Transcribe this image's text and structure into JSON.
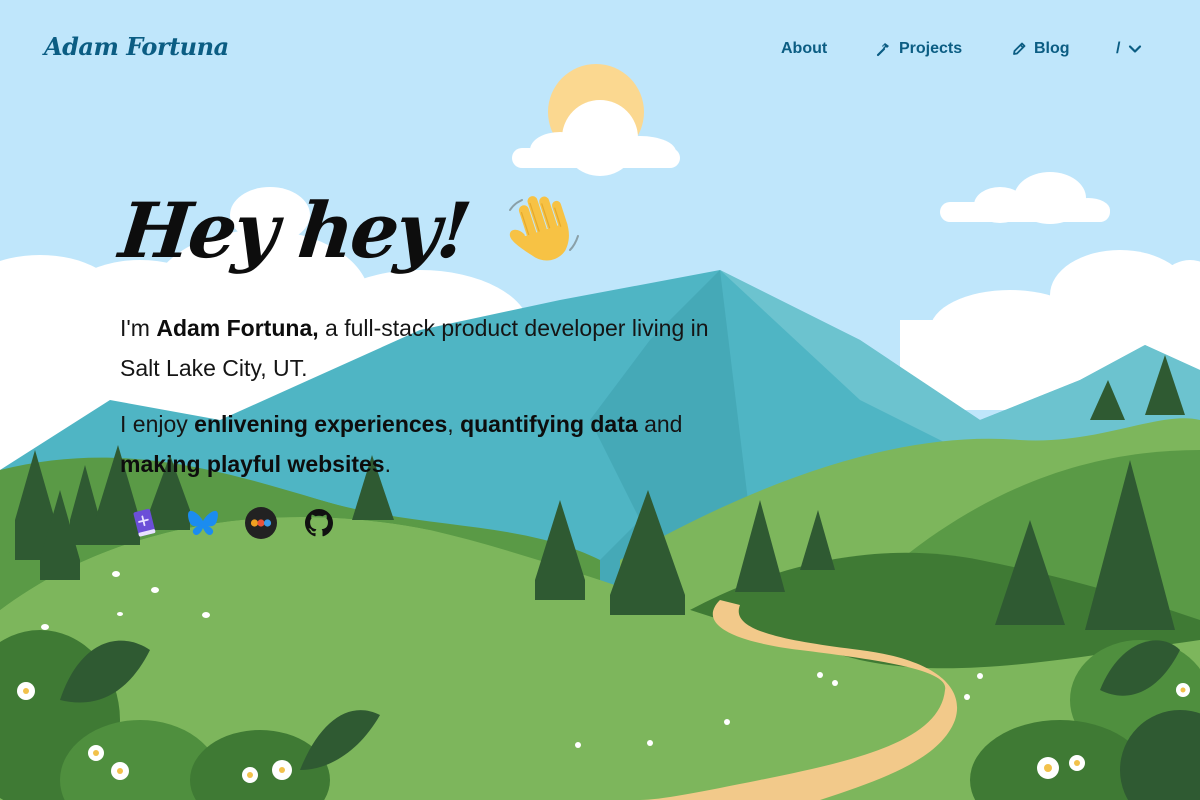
{
  "site": {
    "logo_text": "Adam Fortuna"
  },
  "nav": {
    "about": "About",
    "projects": "Projects",
    "blog": "Blog",
    "language": "/"
  },
  "hero": {
    "greeting": "Hey hey!",
    "intro_prefix": "I'm ",
    "name": "Adam Fortuna,",
    "intro_suffix": " a full-stack product developer living in Salt Lake City, UT.",
    "enjoy_prefix": "I enjoy ",
    "interest_1": "enlivening experiences",
    "sep_1": ", ",
    "interest_2": "quantifying data",
    "sep_2": " and ",
    "interest_3": "making playful websites",
    "enjoy_suffix": "."
  },
  "socials": [
    {
      "icon": "book-icon"
    },
    {
      "icon": "bluesky-icon"
    },
    {
      "icon": "dots-app-icon"
    },
    {
      "icon": "github-icon"
    }
  ],
  "colors": {
    "sky": "#bfe6fb",
    "nav_text": "#0b5d83",
    "mountain": "#4fb5c4",
    "hill_light": "#8bc06a",
    "hill_dark": "#4f8f3e",
    "path": "#f2c98a",
    "tree": "#2f5a32"
  }
}
